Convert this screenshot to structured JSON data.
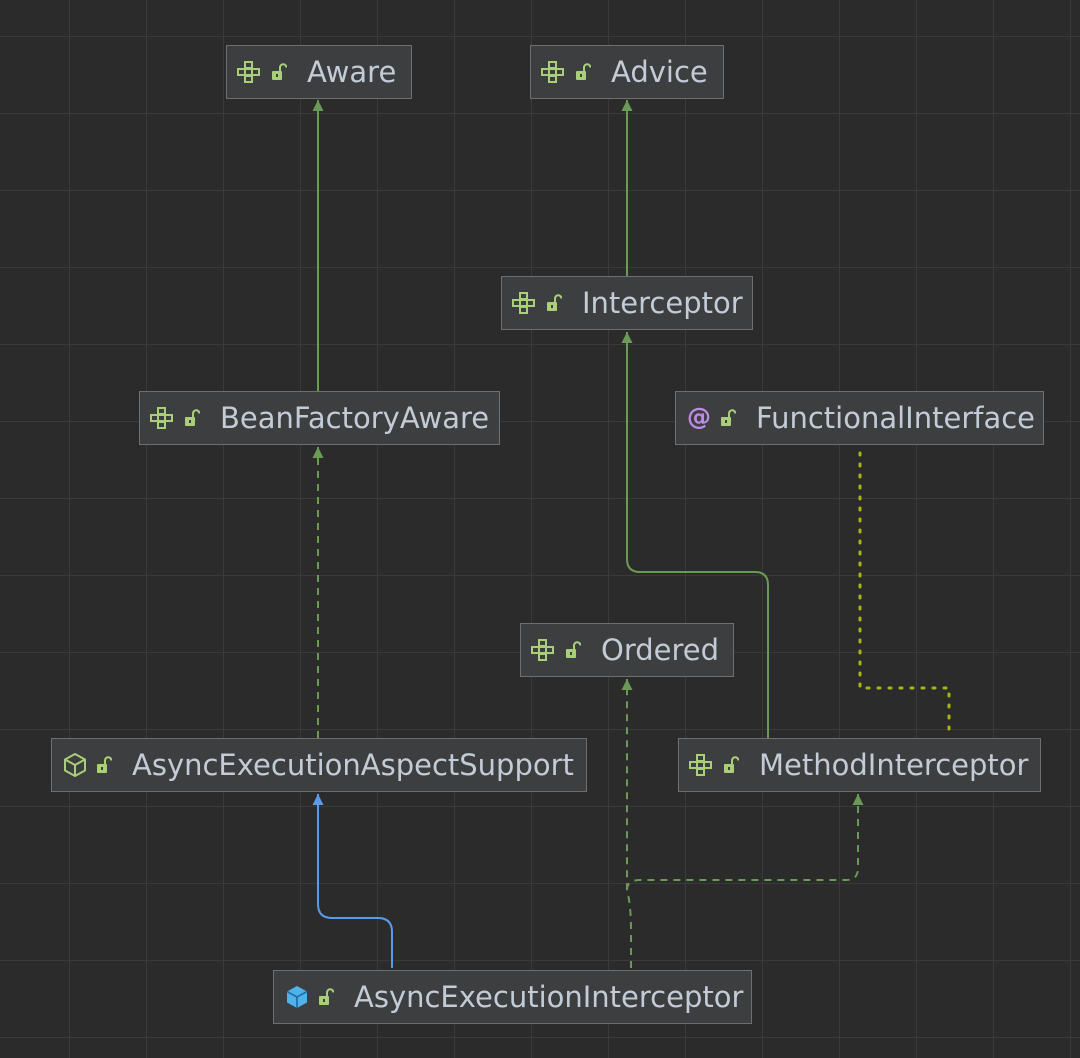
{
  "colors": {
    "background": "#2b2b2c",
    "node_fill": "#3c3e40",
    "node_border": "#6e6f71",
    "text": "#c3cbd6",
    "extends_edge": "#6a9a55",
    "class_extends_edge": "#5a9ae8",
    "annotation_edge": "#a7b416",
    "interface_icon": "#a9cf78",
    "annotation_icon": "#c08ae8",
    "class_icon": "#4fb3ea"
  },
  "nodes": {
    "aware": {
      "label": "Aware",
      "kind_icon": "interface-icon"
    },
    "advice": {
      "label": "Advice",
      "kind_icon": "interface-icon"
    },
    "interceptor": {
      "label": "Interceptor",
      "kind_icon": "interface-icon"
    },
    "bean_factory_aware": {
      "label": "BeanFactoryAware",
      "kind_icon": "interface-icon"
    },
    "functional_interface": {
      "label": "FunctionalInterface",
      "kind_icon": "annotation-icon"
    },
    "ordered": {
      "label": "Ordered",
      "kind_icon": "interface-icon"
    },
    "async_execution_aspect_support": {
      "label": "AsyncExecutionAspectSupport",
      "kind_icon": "abstract-class-icon"
    },
    "method_interceptor": {
      "label": "MethodInterceptor",
      "kind_icon": "interface-icon"
    },
    "async_execution_interceptor": {
      "label": "AsyncExecutionInterceptor",
      "kind_icon": "class-icon"
    }
  },
  "edges": [
    {
      "from": "bean_factory_aware",
      "to": "aware",
      "style": "solid"
    },
    {
      "from": "interceptor",
      "to": "advice",
      "style": "solid"
    },
    {
      "from": "method_interceptor",
      "to": "interceptor",
      "style": "solid"
    },
    {
      "from": "async_execution_aspect_support",
      "to": "bean_factory_aware",
      "style": "dashed"
    },
    {
      "from": "method_interceptor",
      "to": "functional_interface",
      "style": "dotted"
    },
    {
      "from": "async_execution_interceptor",
      "to": "async_execution_aspect_support",
      "style": "solid-blue"
    },
    {
      "from": "async_execution_interceptor",
      "to": "ordered",
      "style": "dashed"
    },
    {
      "from": "async_execution_interceptor",
      "to": "method_interceptor",
      "style": "dashed"
    }
  ]
}
